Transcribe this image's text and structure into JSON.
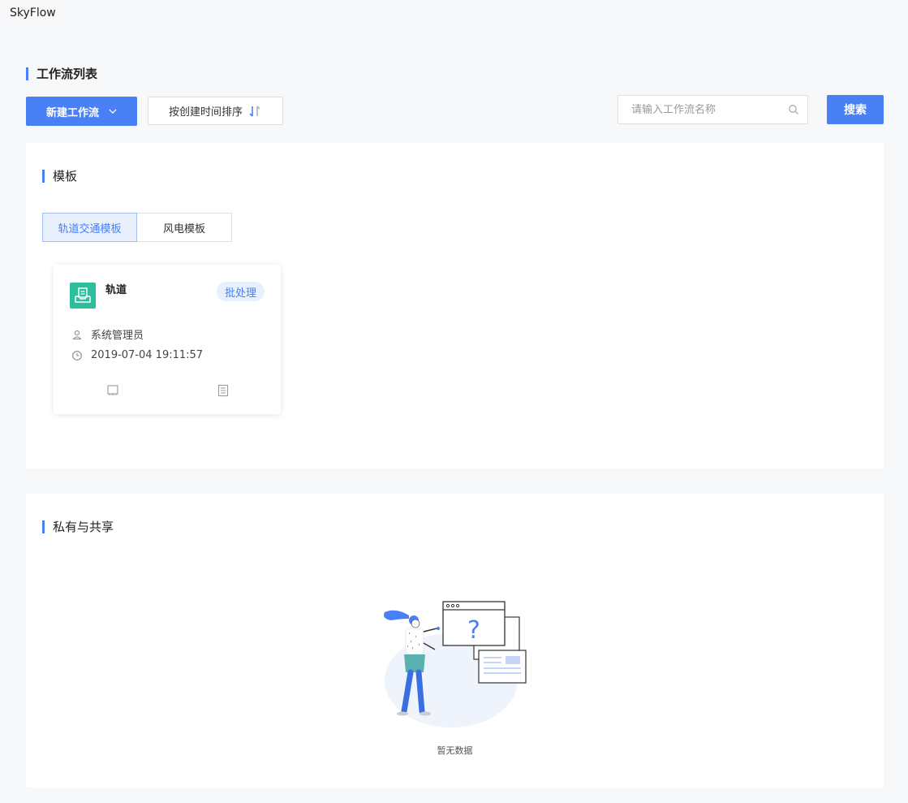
{
  "app": {
    "title": "SkyFlow"
  },
  "page": {
    "title": "工作流列表"
  },
  "toolbar": {
    "new_label": "新建工作流",
    "sort_label": "按创建时间排序",
    "search_placeholder": "请输入工作流名称",
    "search_value": "",
    "search_button": "搜索"
  },
  "templates": {
    "title": "模板",
    "tabs": [
      {
        "label": "轨道交通模板",
        "active": true
      },
      {
        "label": "风电模板",
        "active": false
      }
    ],
    "cards": [
      {
        "name": "轨道",
        "badge": "批处理",
        "owner": "系统管理员",
        "created": "2019-07-04 19:11:57",
        "icon": "inbox-document-icon",
        "icon_color": "#2bbf9e"
      }
    ]
  },
  "private": {
    "title": "私有与共享",
    "empty_text": "暂无数据"
  },
  "colors": {
    "accent": "#4a80f5",
    "accent_light": "#e8effd",
    "card_icon_bg": "#2bbf9e"
  }
}
